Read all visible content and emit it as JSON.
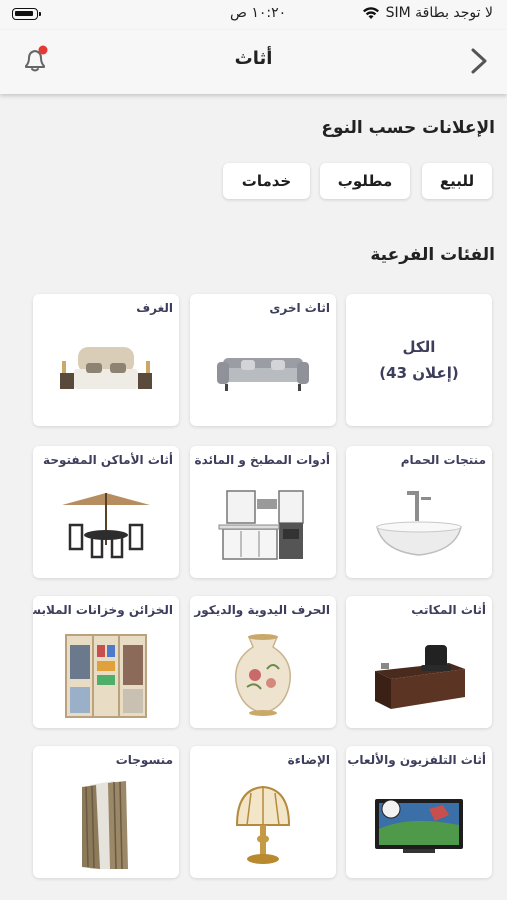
{
  "status_bar": {
    "carrier": "لا توجد بطاقة SIM",
    "time": "١٠:٢٠ ص",
    "wifi_icon": "wifi-icon",
    "battery_icon": "battery-icon"
  },
  "nav": {
    "title": "أثاث",
    "back_icon": "chevron-right-icon",
    "bell_icon": "bell-icon",
    "badge_color": "#e53935"
  },
  "ads_by_type": {
    "title": "الإعلانات حسب النوع",
    "chips": [
      "للبيع",
      "مطلوب",
      "خدمات"
    ]
  },
  "subcategories": {
    "title": "الفئات الفرعية",
    "all_card": {
      "label": "الكل",
      "count": "(43 إعلان)"
    },
    "items": [
      "اثاث اخرى",
      "الغرف",
      "منتجات الحمام",
      "أدوات المطبخ و المائدة",
      "أثاث الأماكن المفتوحة",
      "أثاث المكاتب",
      "الحرف اليدوية والديكور",
      "الخزائن وخزانات الملابس",
      "أثاث التلفزيون والألعاب",
      "الإضاءة",
      "منسوجات"
    ]
  },
  "colors": {
    "accent_text": "#3d3d5c",
    "background": "#f2f2f2",
    "card": "#ffffff"
  }
}
